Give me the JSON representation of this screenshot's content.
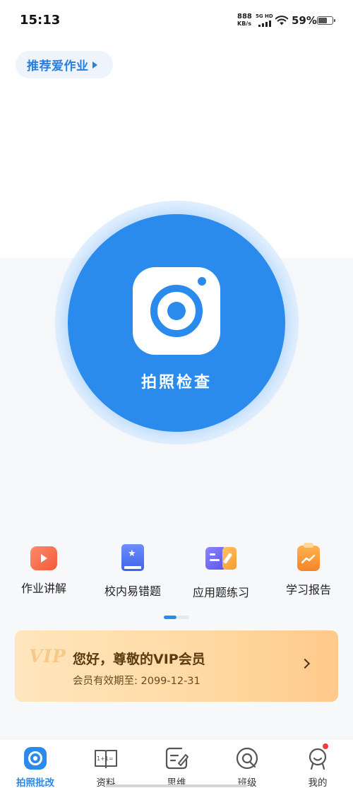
{
  "status_bar": {
    "time": "15:13",
    "net_speed": "888",
    "net_unit": "KB/s",
    "signal_label": "5G HD",
    "battery_percent": "59%"
  },
  "recommend": {
    "label": "推荐爱作业"
  },
  "camera": {
    "label": "拍照检查"
  },
  "tools": [
    {
      "label": "作业讲解",
      "icon": "video-icon"
    },
    {
      "label": "校内易错题",
      "icon": "star-book-icon"
    },
    {
      "label": "应用题练习",
      "icon": "practice-icon"
    },
    {
      "label": "学习报告",
      "icon": "report-icon"
    }
  ],
  "pager": {
    "pages": 2,
    "current": 1
  },
  "vip": {
    "logo": "VIP",
    "title": "您好，尊敬的VIP会员",
    "expiry": "会员有效期至: 2099-12-31"
  },
  "bottom_nav": [
    {
      "label": "拍照批改",
      "icon": "camera-icon",
      "active": true
    },
    {
      "label": "资料",
      "icon": "book-icon",
      "active": false
    },
    {
      "label": "思维",
      "icon": "edit-icon",
      "active": false
    },
    {
      "label": "班级",
      "icon": "class-icon",
      "active": false
    },
    {
      "label": "我的",
      "icon": "profile-icon",
      "active": false,
      "badge": true
    }
  ],
  "colors": {
    "primary": "#2a8bec",
    "vip_text": "#5c3a12",
    "badge": "#f43a3a"
  }
}
